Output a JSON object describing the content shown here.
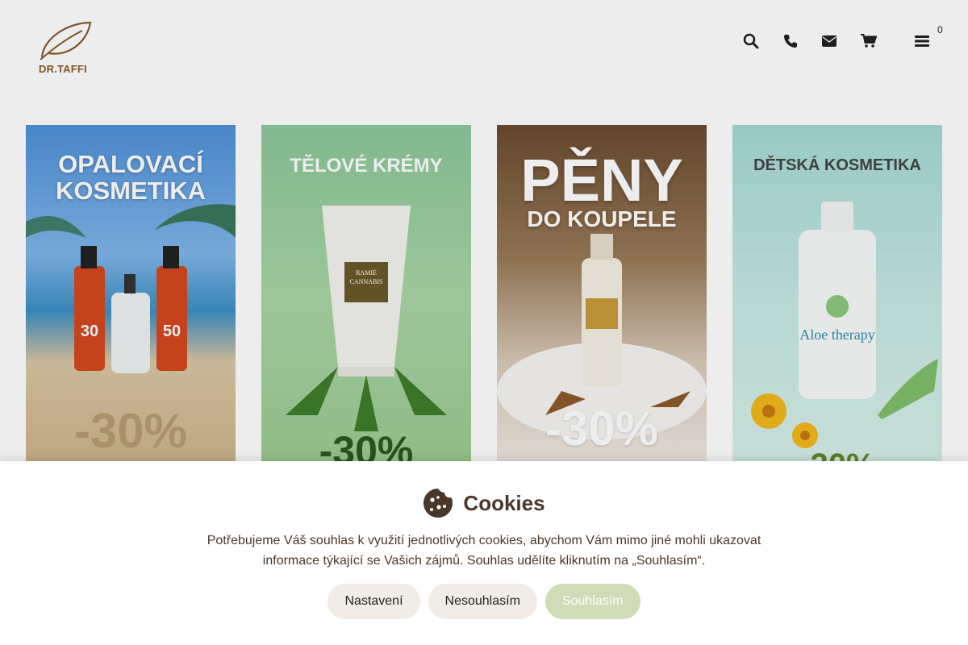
{
  "header": {
    "logo_text": "DR.TAFFI",
    "cart_count": "0",
    "icons": [
      "search-icon",
      "phone-icon",
      "envelope-icon",
      "cart-icon",
      "menu-icon"
    ]
  },
  "cards": [
    {
      "title_line1": "OPALOVACÍ",
      "title_line2": "KOSMETIKA",
      "discount": "-30%"
    },
    {
      "title_line1": "TĚLOVÉ KRÉMY",
      "product_label": "RAMIÈ CANNABIS",
      "discount": "-30%"
    },
    {
      "title_line1": "PĚNY",
      "title_line2": "DO KOUPELE",
      "discount": "-30%"
    },
    {
      "title_line1": "DĚTSKÁ KOSMETIKA",
      "product_label": "Aloe therapy",
      "discount": "-30%"
    }
  ],
  "cookies": {
    "title": "Cookies",
    "text": "Potřebujeme Váš souhlas k využití jednotlivých cookies, abychom Vám mimo jiné mohli ukazovat informace týkající se Vašich zájmů. Souhlas udělíte kliknutím na „Souhlasím“.",
    "settings_label": "Nastavení",
    "decline_label": "Nesouhlasím",
    "accept_label": "Souhlasím"
  },
  "colors": {
    "brand": "#8a5a2b",
    "cookie_text": "#4a3728",
    "accept_button": "#cfdcb6",
    "secondary_button": "#f1ede6"
  }
}
